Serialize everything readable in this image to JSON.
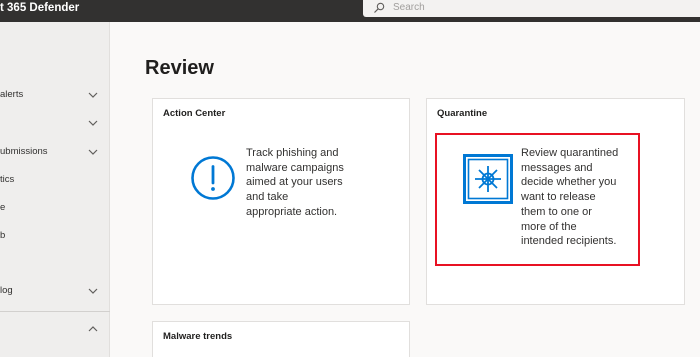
{
  "header": {
    "app_title": "t 365 Defender",
    "search_placeholder": "Search"
  },
  "sidebar": {
    "items": [
      {
        "label": "alerts",
        "chevron": "chevron-down"
      },
      {
        "label": "",
        "chevron": "chevron-down"
      },
      {
        "label": "ubmissions",
        "chevron": "chevron-down"
      },
      {
        "label": "tics"
      },
      {
        "label": "e"
      },
      {
        "label": "b"
      },
      {
        "label": "log",
        "chevron": "chevron-down"
      },
      {
        "label": "",
        "chevron": "chevron-up"
      }
    ]
  },
  "page": {
    "title": "Review"
  },
  "cards": {
    "action_center": {
      "title": "Action Center",
      "lines": [
        "Track phishing and",
        "malware campaigns",
        "aimed at your users",
        "and take",
        "appropriate action."
      ],
      "icon": "alert-circle-icon"
    },
    "quarantine": {
      "title": "Quarantine",
      "lines": [
        "Review quarantined",
        "messages and",
        "decide whether you",
        "want to release",
        "them to one or",
        "more of the",
        "intended recipients."
      ],
      "icon": "vault-icon"
    },
    "malware_trends": {
      "title": "Malware trends"
    }
  },
  "colors": {
    "topbar": "#323130",
    "accent": "#0078d4",
    "highlight": "#e81123"
  }
}
